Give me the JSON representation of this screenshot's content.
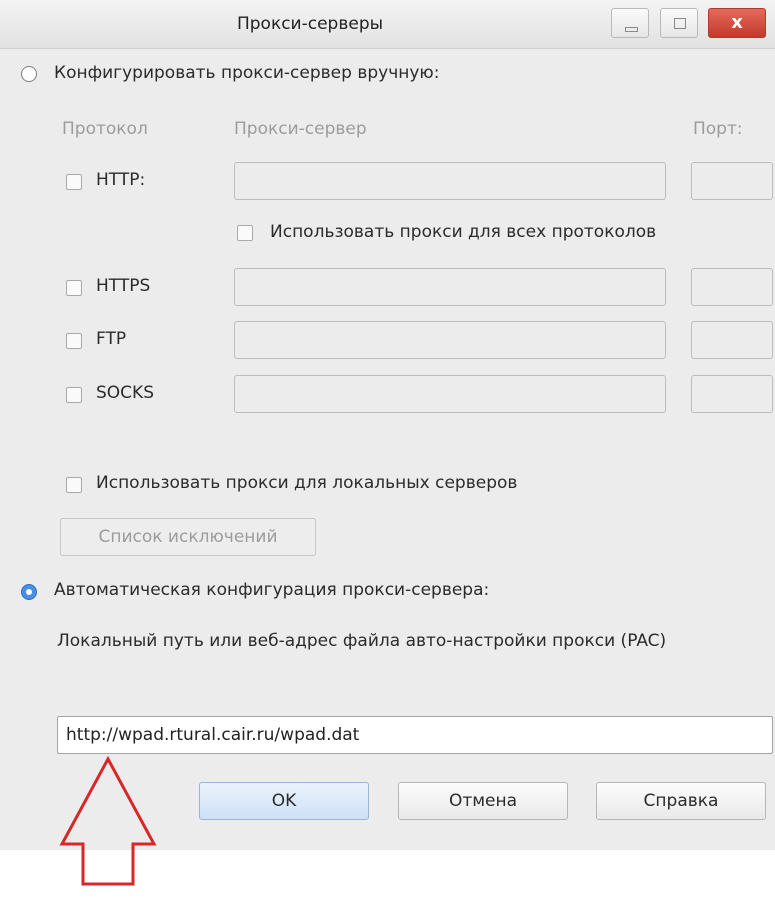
{
  "window": {
    "title": "Прокси-серверы",
    "close_glyph": "x"
  },
  "manual": {
    "radio_label": "Конфигурировать прокси-сервер вручную:",
    "header_protocol": "Протокол",
    "header_server": "Прокси-сервер",
    "header_port": "Порт:",
    "rows": [
      {
        "protocol": "HTTP:",
        "server": "",
        "port": ""
      },
      {
        "protocol": "HTTPS",
        "server": "",
        "port": ""
      },
      {
        "protocol": "FTP",
        "server": "",
        "port": ""
      },
      {
        "protocol": "SOCKS",
        "server": "",
        "port": ""
      }
    ],
    "use_all_label": "Использовать прокси для всех протоколов",
    "use_local_label": "Использовать прокси для локальных серверов",
    "exceptions_button": "Список исключений"
  },
  "auto": {
    "radio_label": "Автоматическая конфигурация прокси-сервера:",
    "pac_label": "Локальный путь или веб-адрес файла авто-настройки прокси (PAC)",
    "pac_value": "http://wpad.rtural.cair.ru/wpad.dat"
  },
  "buttons": {
    "ok": "OK",
    "cancel": "Отмена",
    "help": "Справка"
  },
  "annotation": {
    "arrow_color": "#d62828",
    "icon": "up-arrow-icon"
  }
}
